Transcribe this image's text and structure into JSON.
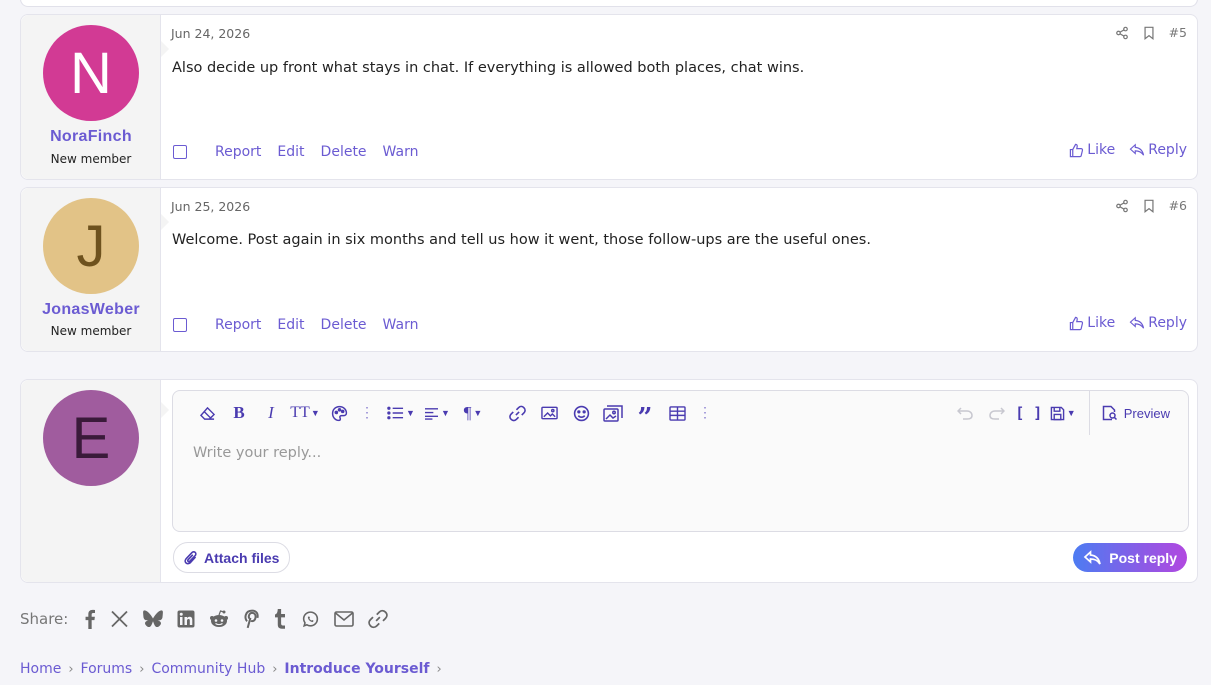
{
  "posts": [
    {
      "avatar_letter": "N",
      "avatar_color": "#d23a94",
      "avatar_text_color": "#ffffff",
      "username": "NoraFinch",
      "user_title": "New member",
      "date": "Jun 24, 2026",
      "post_number": "#5",
      "body": "Also decide up front what stays in chat. If everything is allowed both places, chat wins.",
      "actions": {
        "report": "Report",
        "edit": "Edit",
        "delete": "Delete",
        "warn": "Warn",
        "like": "Like",
        "reply": "Reply"
      }
    },
    {
      "avatar_letter": "J",
      "avatar_color": "#e2c387",
      "avatar_text_color": "#6e521e",
      "username": "JonasWeber",
      "user_title": "New member",
      "date": "Jun 25, 2026",
      "post_number": "#6",
      "body": "Welcome. Post again in six months and tell us how it went, those follow-ups are the useful ones.",
      "actions": {
        "report": "Report",
        "edit": "Edit",
        "delete": "Delete",
        "warn": "Warn",
        "like": "Like",
        "reply": "Reply"
      }
    }
  ],
  "reply": {
    "avatar_letter": "E",
    "avatar_color": "#a05c9e",
    "avatar_text_color": "#3a1a3a",
    "placeholder": "Write your reply...",
    "preview_label": "Preview",
    "attach_label": "Attach files",
    "post_reply_label": "Post reply"
  },
  "share": {
    "label": "Share:",
    "icons": [
      "facebook-icon",
      "x-icon",
      "bluesky-icon",
      "linkedin-icon",
      "reddit-icon",
      "pinterest-icon",
      "tumblr-icon",
      "whatsapp-icon",
      "email-icon",
      "link-icon"
    ]
  },
  "breadcrumb": {
    "home": "Home",
    "forums": "Forums",
    "community_hub": "Community Hub",
    "current": "Introduce Yourself"
  },
  "colors": {
    "accent": "#6b5bd2",
    "toolbar_icon": "#4a3bb0"
  }
}
